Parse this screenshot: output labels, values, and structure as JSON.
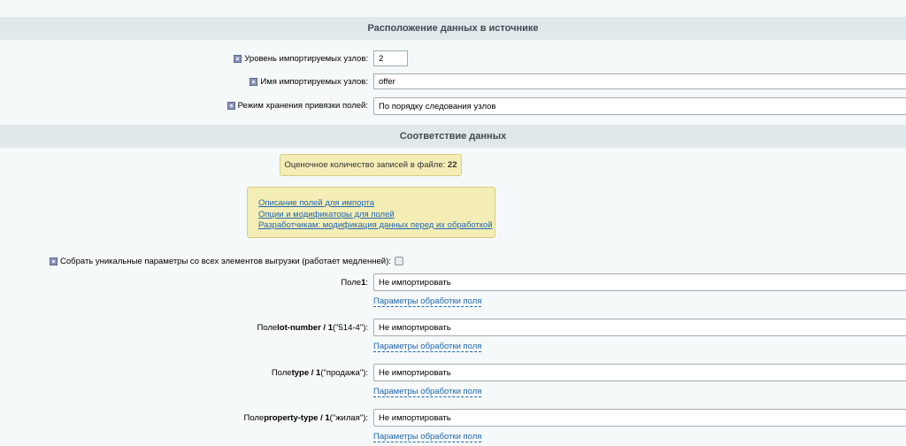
{
  "section_location": {
    "title": "Расположение данных в источнике"
  },
  "fields": {
    "level_label": "Уровень импортируемых узлов:",
    "level_value": "2",
    "name_label": "Имя импортируемых узлов:",
    "name_value": "offer",
    "mode_label": "Режим хранения привязки полей:",
    "mode_value": "По порядку следования узлов"
  },
  "section_mapping": {
    "title": "Соответствие данных"
  },
  "count": {
    "label": "Оценочное количество записей в файле:",
    "value": "22"
  },
  "links": [
    "Описание полей для импорта",
    "Опции и модификаторы для полей",
    "Разработчикам: модификация данных перед их обработкой"
  ],
  "collect_unique_label": "Собрать уникальные параметры со всех элементов выгрузки (работает медленней):",
  "field_rows": [
    {
      "prefix": "Поле ",
      "name": "1",
      "suffix": ":",
      "value": "Не импортировать",
      "link": "Параметры обработки поля"
    },
    {
      "prefix": "Поле ",
      "name": "lot-number / 1",
      "suffix": " (\"514-4\"):",
      "value": "Не импортировать",
      "link": "Параметры обработки поля"
    },
    {
      "prefix": "Поле ",
      "name": "type / 1",
      "suffix": " (\"продажа\"):",
      "value": "Не импортировать",
      "link": "Параметры обработки поля"
    },
    {
      "prefix": "Поле ",
      "name": "property-type / 1",
      "suffix": " (\"жилая\"):",
      "value": "Не импортировать",
      "link": "Параметры обработки поля"
    }
  ]
}
